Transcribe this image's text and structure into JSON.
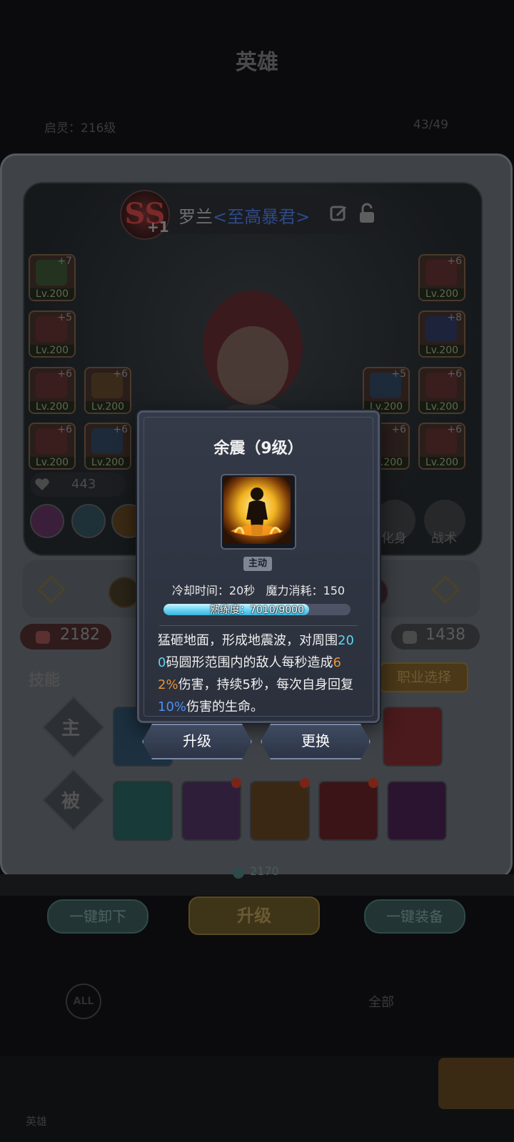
{
  "background": {
    "page_title": "英雄",
    "sub_left": "启灵：216级",
    "sub_right": "43/49",
    "hero": {
      "rank": "SS",
      "rank_plus": "+1",
      "name": "罗兰",
      "title": "<至高暴君>"
    },
    "equipment": [
      {
        "plus": "+7",
        "level": "Lv.200",
        "color": "#23331f"
      },
      {
        "plus": "+5",
        "level": "Lv.200",
        "color": "#3a1d1d"
      },
      {
        "plus": "+6",
        "level": "Lv.200",
        "color": "#3a1d1d"
      },
      {
        "plus": "+6",
        "level": "Lv.200",
        "color": "#3a1d1d"
      },
      {
        "plus": "+6",
        "level": "Lv.200",
        "color": "#3a2a1a"
      },
      {
        "plus": "+6",
        "level": "Lv.200",
        "color": "#1d2a3a"
      },
      {
        "plus": "+6",
        "level": "Lv.200",
        "color": "#3a1d1d"
      },
      {
        "plus": "+8",
        "level": "Lv.200",
        "color": "#1d233a"
      },
      {
        "plus": "+5",
        "level": "Lv.200",
        "color": "#1d2a3a"
      },
      {
        "plus": "+6",
        "level": "Lv.200",
        "color": "#3a1d1d"
      },
      {
        "plus": "+6",
        "level": "Lv.200",
        "color": "#2a1d1d"
      },
      {
        "plus": "+6",
        "level": "Lv.200",
        "color": "#3a1d1d"
      }
    ],
    "power": "443",
    "side_buttons": [
      "化身",
      "战术"
    ],
    "stats": {
      "attack": "2182",
      "defense": "1438"
    },
    "skills_label": "技能",
    "job_button": "职业选择",
    "row_labels": {
      "active": "主",
      "passive": "被"
    },
    "coins": "2170",
    "unequip_all": "一键卸下",
    "upgrade": "升级",
    "equip_all": "一键装备",
    "filter_all_badge": "ALL",
    "filter_all_text": "全部",
    "tabs": [
      "英雄",
      "",
      "",
      "",
      ""
    ]
  },
  "popup": {
    "title": "余震（9级）",
    "type_tag": "主动",
    "cooldown_label": "冷却时间：",
    "cooldown_value": "20秒",
    "mana_label": "魔力消耗：",
    "mana_value": "150",
    "proficiency_label": "熟练度：",
    "proficiency_current": 7010,
    "proficiency_max": 9000,
    "proficiency_text": "7010/9000",
    "description": {
      "part1": "猛砸地面，形成地震波，对周围",
      "range": "200",
      "part2": "码圆形范围内的敌人每秒造成",
      "damage": "62%",
      "part3": "伤害，持续5秒，每次自身回复",
      "heal": "10%",
      "part4": "伤害的生命。"
    },
    "upgrade_button": "升级",
    "replace_button": "更换"
  }
}
